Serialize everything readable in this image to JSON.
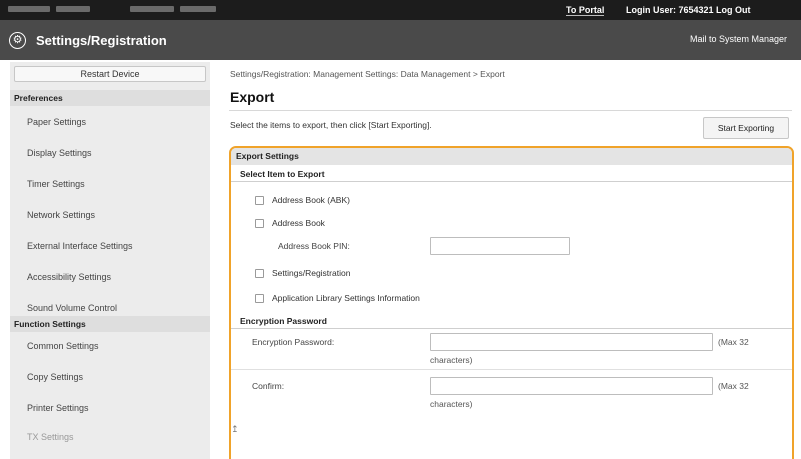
{
  "topbar": {
    "portal_link": "To Portal",
    "login_user": "Login User:  7654321  Log Out"
  },
  "header": {
    "title": "Settings/Registration",
    "mail_link": "Mail to System Manager"
  },
  "sidebar": {
    "restart_button": "Restart Device",
    "preferences_heading": "Preferences",
    "preferences_items": [
      "Paper Settings",
      "Display Settings",
      "Timer Settings",
      "Network Settings",
      "External Interface Settings",
      "Accessibility Settings",
      "Sound Volume Control"
    ],
    "function_heading": "Function Settings",
    "function_items": [
      "Common Settings",
      "Copy Settings",
      "Printer Settings",
      "TX Settings"
    ]
  },
  "main": {
    "breadcrumb": "Settings/Registration: Management Settings: Data Management > Export",
    "title": "Export",
    "instruction": "Select the items to export, then click [Start Exporting].",
    "start_button": "Start Exporting",
    "export_settings": {
      "heading": "Export Settings",
      "select_heading": "Select Item to Export",
      "items": [
        "Address Book (ABK)",
        "Address Book",
        "Settings/Registration",
        "Application Library Settings Information"
      ],
      "address_pin_label": "Address Book PIN:",
      "address_pin_value": "",
      "encryption_heading": "Encryption Password",
      "encryption_label": "Encryption Password:",
      "encryption_value": "",
      "confirm_label": "Confirm:",
      "confirm_value": "",
      "max_note_1": "(Max 32",
      "max_note_2": "characters)"
    },
    "up_symbol": "↥"
  }
}
